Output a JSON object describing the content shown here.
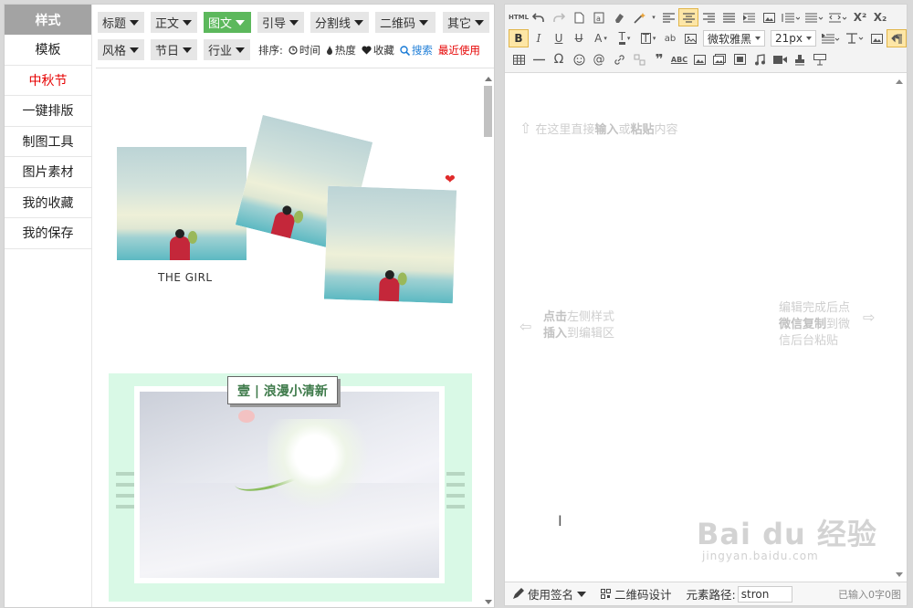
{
  "sidebar": {
    "header": "样式",
    "items": [
      "模板",
      "中秋节",
      "一键排版",
      "制图工具",
      "图片素材",
      "我的收藏",
      "我的保存"
    ]
  },
  "toolbar": {
    "row1": [
      "标题",
      "正文",
      "图文",
      "引导",
      "分割线",
      "二维码",
      "其它"
    ],
    "row2": [
      "风格",
      "节日",
      "行业"
    ],
    "active": "图文",
    "sort_label": "排序:",
    "sort_time": "时间",
    "sort_hot": "热度",
    "sort_fav": "收藏",
    "search": "搜索",
    "recent": "最近使用"
  },
  "content": {
    "girl_caption": "THE GIRL",
    "card2_title": "壹 | 浪漫小清新"
  },
  "editor": {
    "font_family": "微软雅黑",
    "font_size": "21px",
    "html_label": "HTML",
    "placeholder_pre": "在这里直接",
    "placeholder_b1": "输入",
    "placeholder_mid": "或",
    "placeholder_b2": "粘贴",
    "placeholder_post": "内容",
    "left_hint_b1": "点击",
    "left_hint_1": "左侧样式",
    "left_hint_b2": "插入",
    "left_hint_2": "到编辑区",
    "right_hint_1": "编辑完成后点",
    "right_hint_b": "微信复制",
    "right_hint_2": "到微",
    "right_hint_3": "信后台粘贴"
  },
  "status": {
    "signature": "使用签名",
    "qrcode": "二维码设计",
    "path_label": "元素路径:",
    "path_value": "stron",
    "count": "已输入0字0图"
  },
  "watermark": {
    "main": "Bai du 经验",
    "sub": "jingyan.baidu.com"
  },
  "colors": {
    "active_tab": "#5cb85c",
    "red": "#e60000",
    "blue": "#1a7bd6",
    "card_bg": "#d9f9e6"
  }
}
